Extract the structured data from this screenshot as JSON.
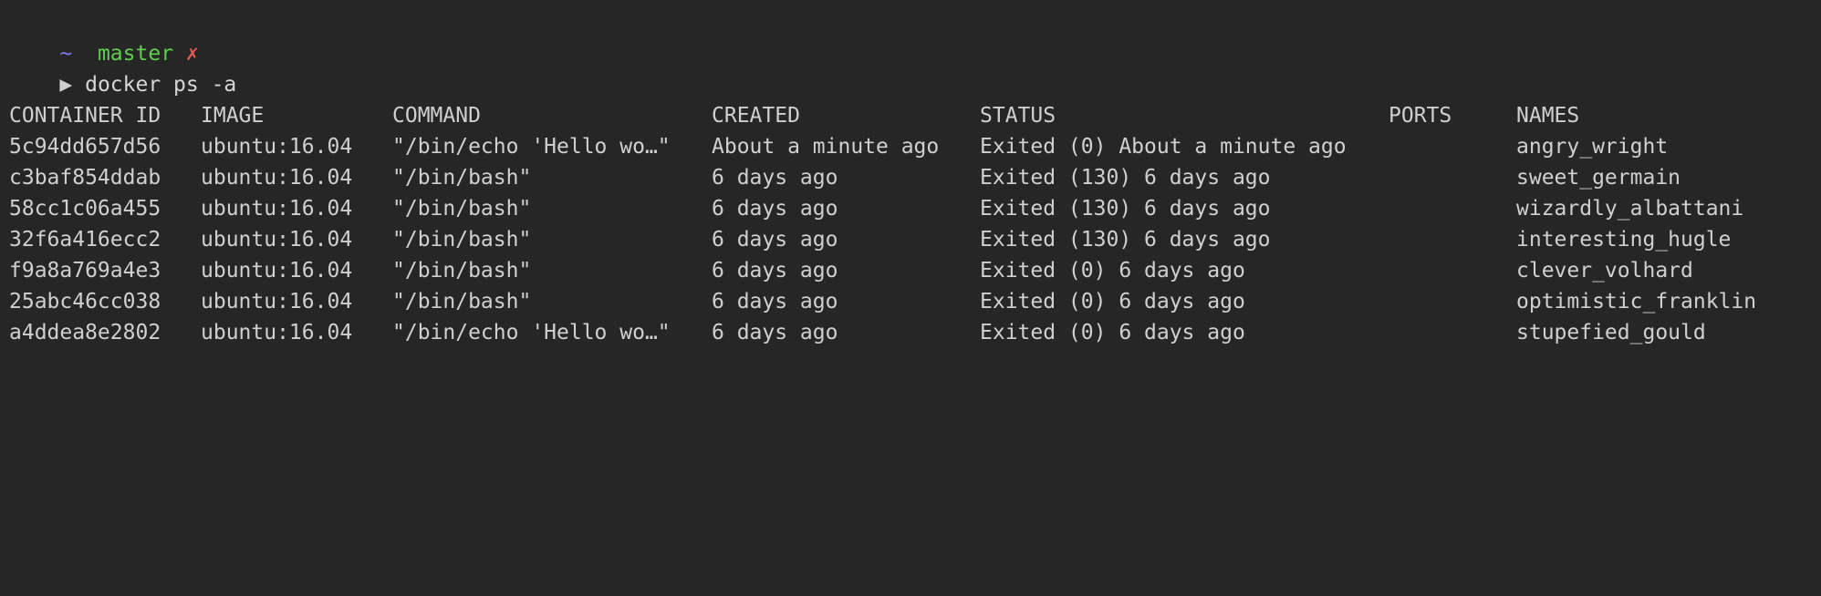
{
  "prompt": {
    "tilde": "~",
    "branch": "master",
    "dirty_marker": "✗",
    "arrow": "▶",
    "command": "docker ps -a"
  },
  "table": {
    "headers": [
      "CONTAINER ID",
      "IMAGE",
      "COMMAND",
      "CREATED",
      "STATUS",
      "PORTS",
      "NAMES"
    ],
    "rows": [
      [
        "5c94dd657d56",
        "ubuntu:16.04",
        "\"/bin/echo 'Hello wo…\"",
        "About a minute ago",
        "Exited (0) About a minute ago",
        "",
        "angry_wright"
      ],
      [
        "c3baf854ddab",
        "ubuntu:16.04",
        "\"/bin/bash\"",
        "6 days ago",
        "Exited (130) 6 days ago",
        "",
        "sweet_germain"
      ],
      [
        "58cc1c06a455",
        "ubuntu:16.04",
        "\"/bin/bash\"",
        "6 days ago",
        "Exited (130) 6 days ago",
        "",
        "wizardly_albattani"
      ],
      [
        "32f6a416ecc2",
        "ubuntu:16.04",
        "\"/bin/bash\"",
        "6 days ago",
        "Exited (130) 6 days ago",
        "",
        "interesting_hugle"
      ],
      [
        "f9a8a769a4e3",
        "ubuntu:16.04",
        "\"/bin/bash\"",
        "6 days ago",
        "Exited (0) 6 days ago",
        "",
        "clever_volhard"
      ],
      [
        "25abc46cc038",
        "ubuntu:16.04",
        "\"/bin/bash\"",
        "6 days ago",
        "Exited (0) 6 days ago",
        "",
        "optimistic_franklin"
      ],
      [
        "a4ddea8e2802",
        "ubuntu:16.04",
        "\"/bin/echo 'Hello wo…\"",
        "6 days ago",
        "Exited (0) 6 days ago",
        "",
        "stupefied_gould"
      ]
    ]
  },
  "colors": {
    "background": "#262626",
    "text": "#d0d0d0",
    "tilde": "#7b7be8",
    "branch": "#5fce4f",
    "dirty": "#e65c4f"
  }
}
